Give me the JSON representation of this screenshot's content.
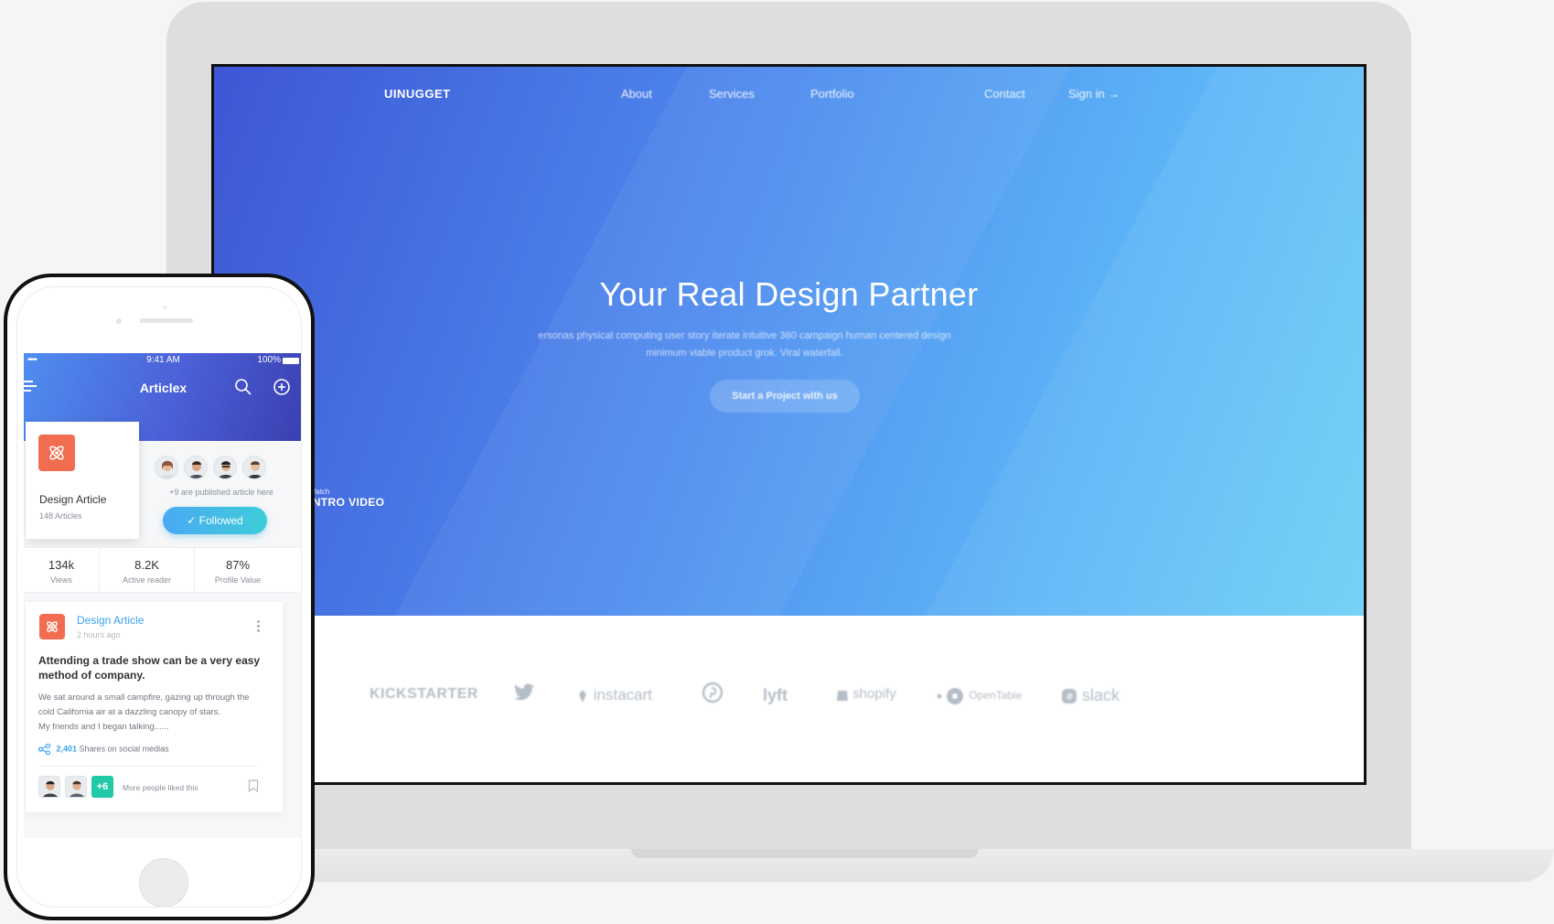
{
  "desktop": {
    "nav": {
      "brand": "UINUGGET",
      "links": [
        "About",
        "Services",
        "Portfolio",
        "Contact",
        "Sign in →"
      ]
    },
    "hero": {
      "title": "Your Real Design Partner",
      "subtitle_line1": "ersonas physical computing user story iterate intuitive 360 campaign human centered design",
      "subtitle_line2": "minimum viable product grok. Viral waterfall.",
      "cta": "Start a Project with us",
      "watch_small": "Watch",
      "watch_big": "INTRO VIDEO"
    },
    "logos": [
      "KICKSTARTER",
      "twitter-icon",
      "instacart",
      "pinterest-icon",
      "lyft",
      "shopify",
      "OpenTable",
      "slack"
    ],
    "colors": {
      "hero_start": "#3e56d4",
      "hero_end": "#6ed0f6"
    }
  },
  "phone": {
    "status": {
      "signal": "••••",
      "time": "9:41 AM",
      "battery": "100%"
    },
    "header": {
      "title": "Articlex"
    },
    "category": {
      "title": "Design Article",
      "count": "148 Articles"
    },
    "people_note": "+9 are published article here",
    "follow_button": "✓  Followed",
    "stats": [
      {
        "value": "134k",
        "label": "Views"
      },
      {
        "value": "8.2K",
        "label": "Active reader"
      },
      {
        "value": "87%",
        "label": "Profile Value"
      }
    ],
    "post": {
      "category": "Design Article",
      "time": "2 hours ago",
      "title": "Attending a trade show can be a very easy method of company.",
      "body_line1": "We sat around a small campfire, gazing up through the",
      "body_line2": "cold California air at a dazzling canopy of stars.",
      "body_line3": "My friends and I began talking......",
      "shares_count": "2,401",
      "shares_label": " Shares on social medias",
      "likers_extra": "+6",
      "likers_note": "More people liked this"
    },
    "colors": {
      "accent": "#3aa2f0",
      "badge": "#f26d4f",
      "plus": "#22c9a6"
    }
  }
}
